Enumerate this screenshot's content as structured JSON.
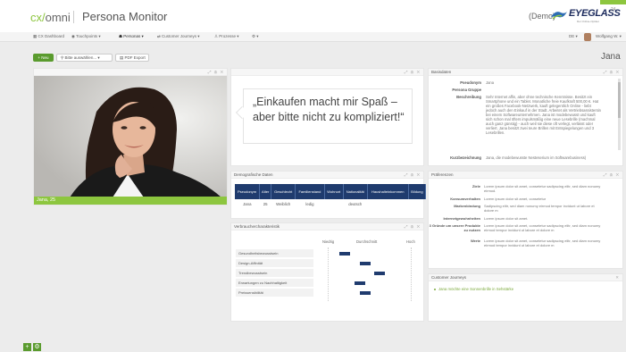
{
  "header": {
    "logo_brand": "cx/",
    "logo_product": "omni",
    "app_title": "Persona Monitor",
    "demo_label": "(Demo)",
    "brand_name": "EYEGLASS",
    "brand_sup": "24",
    "brand_tagline": "Der Online-Optiker",
    "accent_color": "#8dc63f"
  },
  "nav": {
    "items": [
      {
        "label": "CX Dashboard",
        "icon": "dashboard-icon"
      },
      {
        "label": "Touchpoints ▾",
        "icon": "touchpoint-icon"
      },
      {
        "label": "Personas ▾",
        "icon": "persona-icon"
      },
      {
        "label": "Customer Journeys ▾",
        "icon": "journey-icon"
      },
      {
        "label": "Prozesse ▾",
        "icon": "process-icon"
      },
      {
        "label": "⚙ ▾",
        "icon": "gear-icon"
      }
    ],
    "language": "DE ▾",
    "user": "Wolfgang W. ▾"
  },
  "toolbar": {
    "new_label": "+ Neu",
    "select_label": "Bitte auswählen... ▾",
    "pdf_label": "PDF Export",
    "persona_name": "Jana"
  },
  "photo": {
    "caption": "Jana, 25"
  },
  "quote": {
    "text": "„Einkaufen macht mir Spaß – aber bitte nicht zu kompliziert!“"
  },
  "basisdaten": {
    "title": "Basisdaten",
    "rows": [
      {
        "label": "Pseudonym",
        "value": "Jana"
      },
      {
        "label": "Persona Gruppe",
        "value": ""
      },
      {
        "label": "Beschreibung",
        "value": "Sehr Internet affin, aber ohne technische Kenntnisse. Besitzt ein Smartphone und ein Tablet. Monatliche freie Kaufkraft 500,00 €. Hat ein großes Facebook-Netzwerk, kauft gelegentlich Online - liebt jedoch auch den Einkauf in der Stadt. Arbeitet als Vertriebsassistentin bei einem Softwareunternehmen. Jana ist modebewusst und kauft sich schon mal öfters impulsmäßig eine neue Lesebrille (machmal auch ganz günstig) - auch weil sie diese oft verlegt, verlässt oder verliert. Jana besitzt zwei teure Brillen mit Entspiegelungen und 3 Lesebrillen."
      },
      {
        "label": "Kurzbezeichnung",
        "value": "Jana, die modebewusste Nesteserium im Softwarebusiness)"
      }
    ]
  },
  "demografie": {
    "title": "Demografische Daten",
    "columns": [
      "Pseudonym",
      "Alter",
      "Geschlecht",
      "Familienstand",
      "Wohnort",
      "Nationalität",
      "Haushalteinkommen",
      "Bildung"
    ],
    "row": [
      "Jana",
      "25",
      "Weiblich",
      "ledig",
      "",
      "deutsch",
      "",
      ""
    ]
  },
  "verhalten": {
    "title": "Verbrauchercharakteristik",
    "scale": [
      "Niedrig",
      "Durchschnitt",
      "Hoch"
    ],
    "items": [
      {
        "label": "Gesundheitsbewusstsein",
        "value": 0.2
      },
      {
        "label": "Design-Affinität",
        "value": 0.45
      },
      {
        "label": "Trendbewusstsein",
        "value": 0.62
      },
      {
        "label": "Erwartungen zu Nachhaltigkeit",
        "value": 0.38
      },
      {
        "label": "Preissensibilität",
        "value": 0.45
      }
    ]
  },
  "praeferenzen": {
    "title": "Präferenzen",
    "rows": [
      {
        "label": "Ziele",
        "value": "Lorem ipsum dolor sit amet, consetetur sadipscing elitr, sed diam nonumy eirmod."
      },
      {
        "label": "Konsumverhalten",
        "value": "Lorem ipsum dolor sit amet, consetetur"
      },
      {
        "label": "Markenbindung",
        "value": "Sadipscing elitr, sed diam nonumy eirmod tempor invidunt ut labore et dolore m"
      },
      {
        "label": "Internetgewohnheiten",
        "value": "Lorem ipsum dolor sit amet."
      },
      {
        "label": "3 Gründe um unsere Produkte zu nutzen",
        "value": "Lorem ipsum dolor sit amet, consetetur sadipscing elitr, sed diam nonumy eirmod tempor invidunt ut labore et dolore m"
      },
      {
        "label": "Werte",
        "value": "Lorem ipsum dolor sit amet, consetetur sadipscing elitr, sed diam nonumy eirmod tempor invidunt ut labore et dolore m"
      }
    ]
  },
  "journeys": {
    "title": "Customer Journeys",
    "items": [
      "Jana möchte eine Sonnenbrille in Sehstärke"
    ]
  },
  "panel_tools": "⤢ ⚙ ✕",
  "bottom_bar": {
    "add": "+",
    "settings": "⚙"
  }
}
